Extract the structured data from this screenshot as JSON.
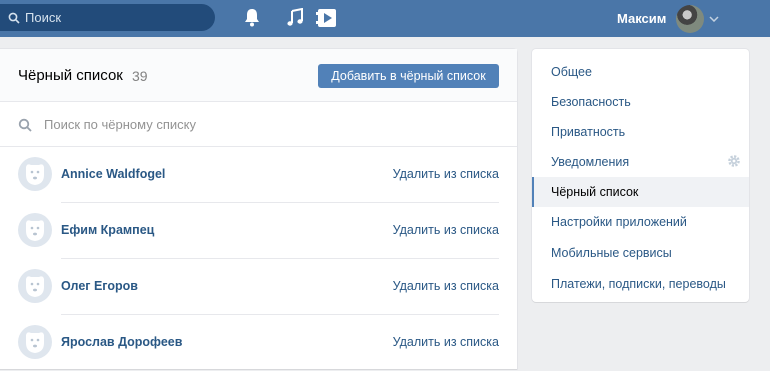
{
  "header": {
    "search_placeholder": "Поиск",
    "user_name": "Максим"
  },
  "blacklist": {
    "title": "Чёрный список",
    "count": "39",
    "add_button": "Добавить в чёрный список",
    "search_placeholder": "Поиск по чёрному списку",
    "remove_label": "Удалить из списка",
    "people": [
      {
        "name": "Annice Waldfogel"
      },
      {
        "name": "Ефим Крампец"
      },
      {
        "name": "Олег Егоров"
      },
      {
        "name": "Ярослав Дорофеев"
      }
    ]
  },
  "sidebar": {
    "items": [
      {
        "label": "Общее"
      },
      {
        "label": "Безопасность"
      },
      {
        "label": "Приватность"
      },
      {
        "label": "Уведомления"
      },
      {
        "label": "Чёрный список"
      },
      {
        "label": "Настройки приложений"
      },
      {
        "label": "Мобильные сервисы"
      },
      {
        "label": "Платежи, подписки, переводы"
      }
    ],
    "active_index": 4
  },
  "colors": {
    "topbar": "#4a76a8",
    "accent": "#5181b8",
    "link": "#2a5885"
  }
}
